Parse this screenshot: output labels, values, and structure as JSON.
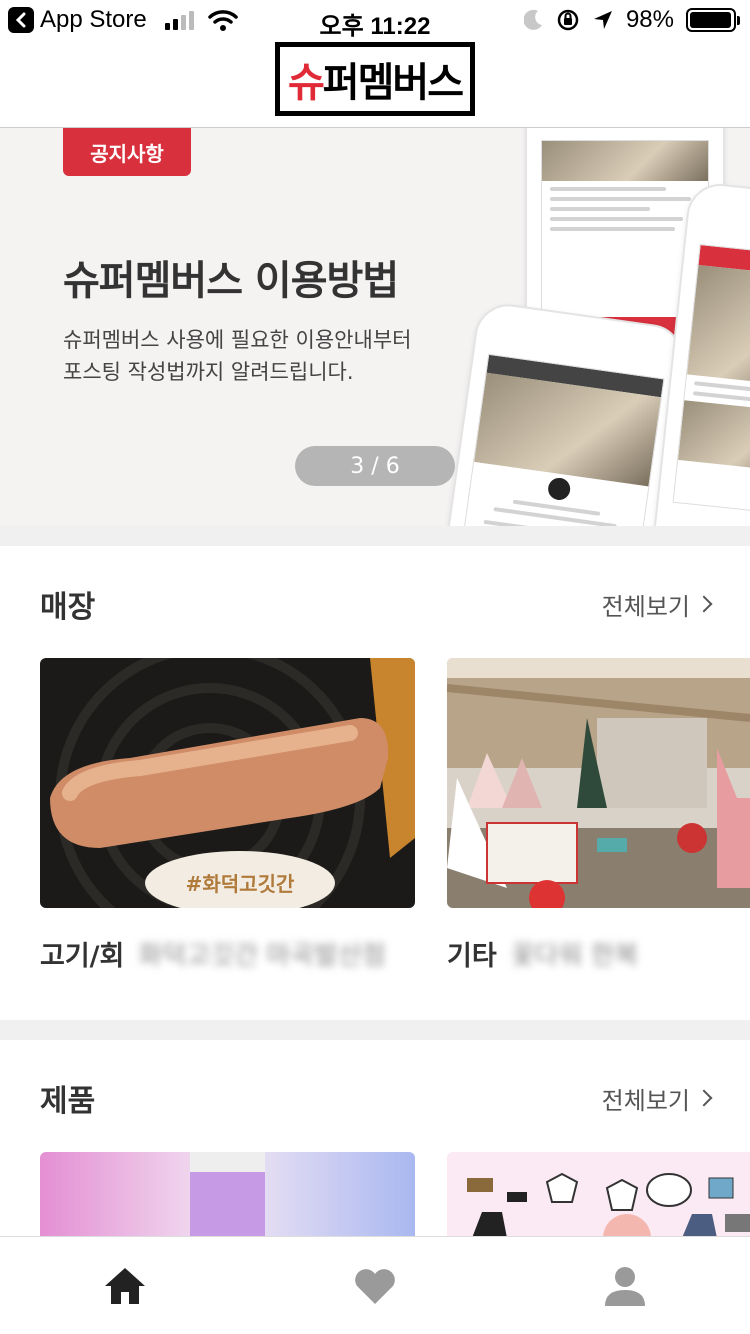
{
  "status_bar": {
    "back_app": "App Store",
    "time": "오후 11:22",
    "battery": "98%",
    "battery_level": 0.98
  },
  "header": {
    "logo_text": "슈퍼멤버스"
  },
  "banner": {
    "tag": "공지사항",
    "title": "슈퍼멤버스 이용방법",
    "description": "슈퍼멤버스 사용에 필요한 이용안내부터\n포스팅 작성법까지 알려드립니다.",
    "pager": "3 / 6"
  },
  "stores": {
    "title": "매장",
    "see_all": "전체보기",
    "items": [
      {
        "category": "고기/회",
        "name": "화덕고깃간 마곡발산점"
      },
      {
        "category": "기타",
        "name": "꽃다워 한복"
      }
    ]
  },
  "products": {
    "title": "제품",
    "see_all": "전체보기"
  },
  "tabbar": {
    "items": [
      "home-icon",
      "heart-icon",
      "person-icon"
    ]
  },
  "colors": {
    "accent": "#d8303d",
    "tab_active": "#222222",
    "tab_inactive": "#9a9a9a"
  }
}
